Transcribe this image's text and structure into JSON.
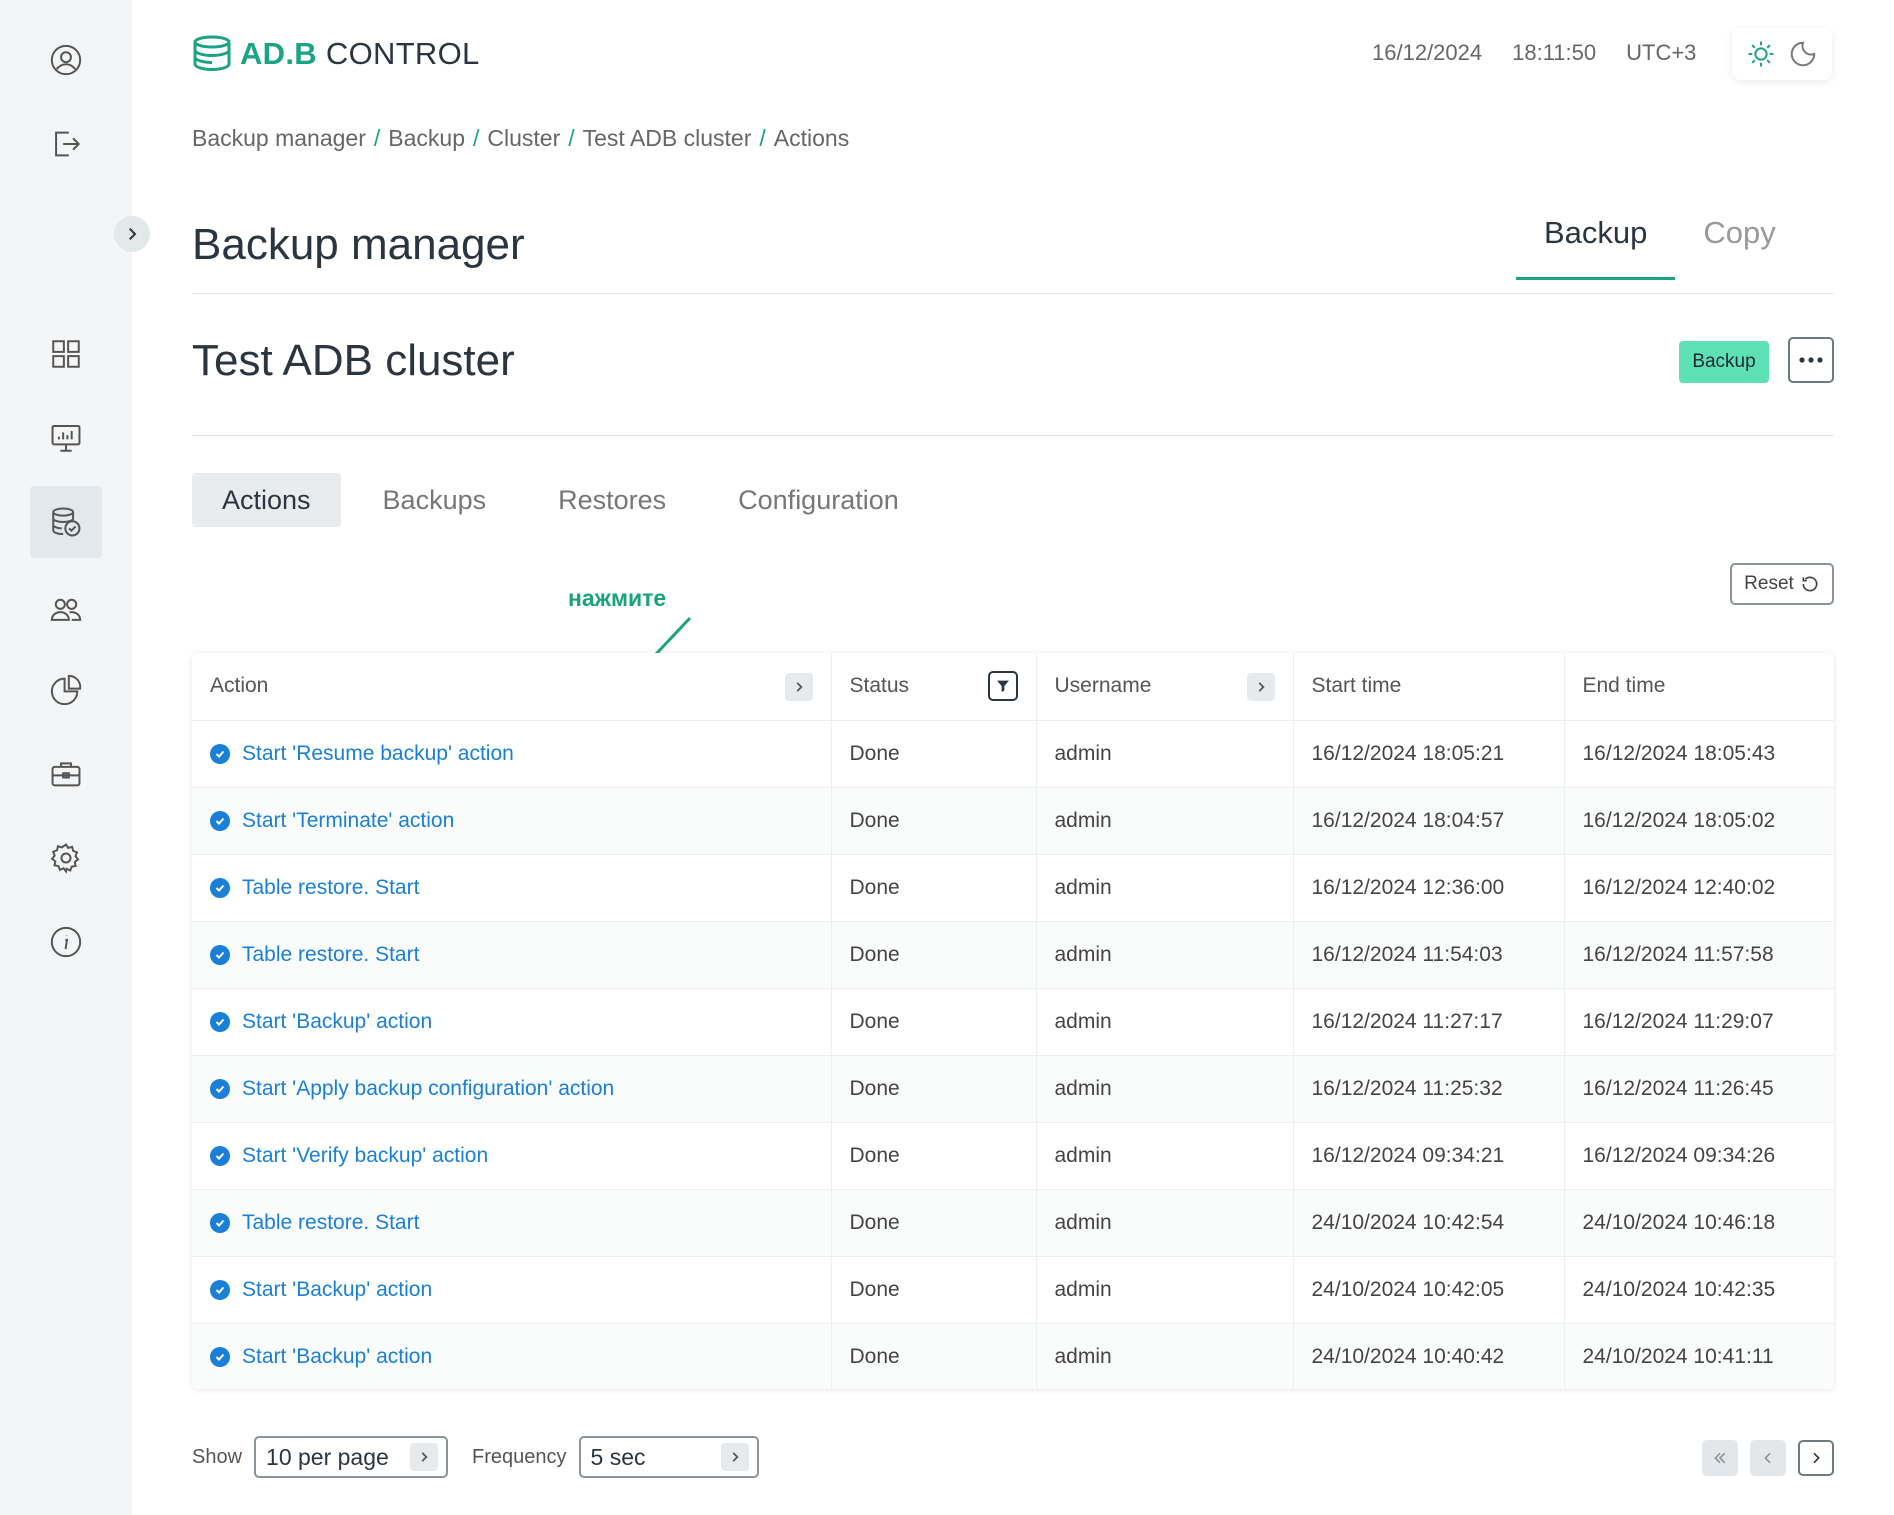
{
  "header": {
    "logo_green": "AD.B",
    "logo_dark": "CONTROL",
    "date": "16/12/2024",
    "time": "18:11:50",
    "timezone": "UTC+3"
  },
  "sidebar": {
    "items": [
      {
        "icon": "user-icon"
      },
      {
        "icon": "logout-icon"
      },
      {
        "icon": "dashboard-icon"
      },
      {
        "icon": "monitoring-icon"
      },
      {
        "icon": "backup-database-icon"
      },
      {
        "icon": "users-icon"
      },
      {
        "icon": "pie-chart-icon"
      },
      {
        "icon": "briefcase-icon"
      },
      {
        "icon": "gear-icon"
      },
      {
        "icon": "info-icon"
      }
    ]
  },
  "breadcrumb": [
    "Backup manager",
    "Backup",
    "Cluster",
    "Test ADB cluster",
    "Actions"
  ],
  "page": {
    "title": "Backup manager",
    "tabs": [
      "Backup",
      "Copy"
    ],
    "active_tab": "Backup",
    "cluster_title": "Test ADB cluster",
    "backup_button": "Backup",
    "more_button": "•••"
  },
  "sub_tabs": [
    "Actions",
    "Backups",
    "Restores",
    "Configuration"
  ],
  "reset_label": "Reset",
  "annotation": "нажмите",
  "table": {
    "columns": [
      "Action",
      "Status",
      "Username",
      "Start time",
      "End time"
    ],
    "rows": [
      {
        "action": "Start 'Resume backup' action",
        "status": "Done",
        "user": "admin",
        "start": "16/12/2024 18:05:21",
        "end": "16/12/2024 18:05:43"
      },
      {
        "action": "Start 'Terminate' action",
        "status": "Done",
        "user": "admin",
        "start": "16/12/2024 18:04:57",
        "end": "16/12/2024 18:05:02"
      },
      {
        "action": "Table restore. Start",
        "status": "Done",
        "user": "admin",
        "start": "16/12/2024 12:36:00",
        "end": "16/12/2024 12:40:02"
      },
      {
        "action": "Table restore. Start",
        "status": "Done",
        "user": "admin",
        "start": "16/12/2024 11:54:03",
        "end": "16/12/2024 11:57:58"
      },
      {
        "action": "Start 'Backup' action",
        "status": "Done",
        "user": "admin",
        "start": "16/12/2024 11:27:17",
        "end": "16/12/2024 11:29:07"
      },
      {
        "action": "Start 'Apply backup configuration' action",
        "status": "Done",
        "user": "admin",
        "start": "16/12/2024 11:25:32",
        "end": "16/12/2024 11:26:45"
      },
      {
        "action": "Start 'Verify backup' action",
        "status": "Done",
        "user": "admin",
        "start": "16/12/2024 09:34:21",
        "end": "16/12/2024 09:34:26"
      },
      {
        "action": "Table restore. Start",
        "status": "Done",
        "user": "admin",
        "start": "24/10/2024 10:42:54",
        "end": "24/10/2024 10:46:18"
      },
      {
        "action": "Start 'Backup' action",
        "status": "Done",
        "user": "admin",
        "start": "24/10/2024 10:42:05",
        "end": "24/10/2024 10:42:35"
      },
      {
        "action": "Start 'Backup' action",
        "status": "Done",
        "user": "admin",
        "start": "24/10/2024 10:40:42",
        "end": "24/10/2024 10:41:11"
      }
    ]
  },
  "footer": {
    "show_label": "Show",
    "per_page": "10 per page",
    "frequency_label": "Frequency",
    "frequency": "5 sec"
  },
  "colors": {
    "accent": "#1aa384",
    "link": "#1a7fd6",
    "backup_button": "#5ee0b5"
  }
}
